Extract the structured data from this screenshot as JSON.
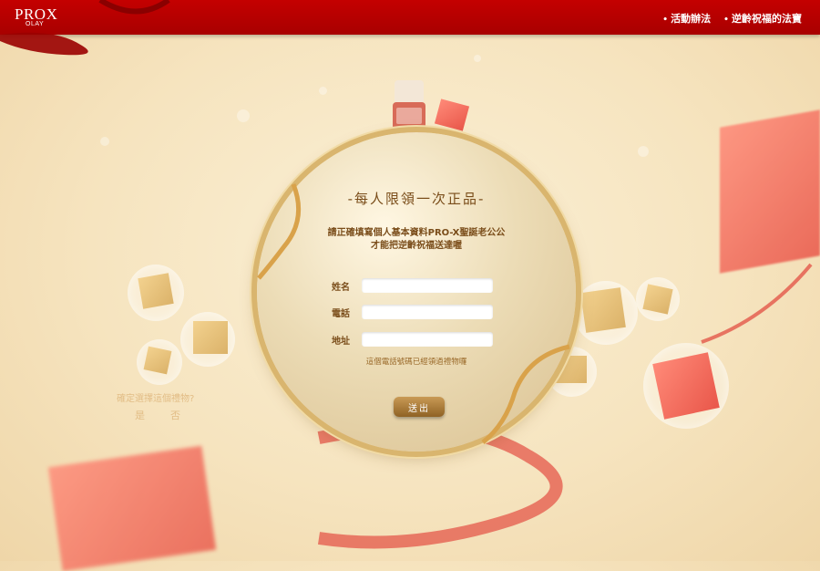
{
  "header": {
    "logo_text": "PROX",
    "logo_sub": "OLAY",
    "nav": [
      {
        "label": "活動辦法"
      },
      {
        "label": "逆齡祝福的法寶"
      }
    ]
  },
  "form": {
    "title": "-每人限領一次正品-",
    "desc_line1": "請正確填寫個人基本資料PRO-X聖誕老公公",
    "desc_line2": "才能把逆齡祝福送達喔",
    "fields": [
      {
        "label": "姓名",
        "value": ""
      },
      {
        "label": "電話",
        "value": ""
      },
      {
        "label": "地址",
        "value": ""
      }
    ],
    "warning": "這個電話號碼已經領過禮物囉",
    "submit_label": "送出"
  },
  "confirm": {
    "question": "確定選擇這個禮物?",
    "yes": "是",
    "no": "否"
  },
  "colors": {
    "header_red": "#b80000",
    "form_text": "#7a4d1a",
    "button": "#a87638"
  }
}
